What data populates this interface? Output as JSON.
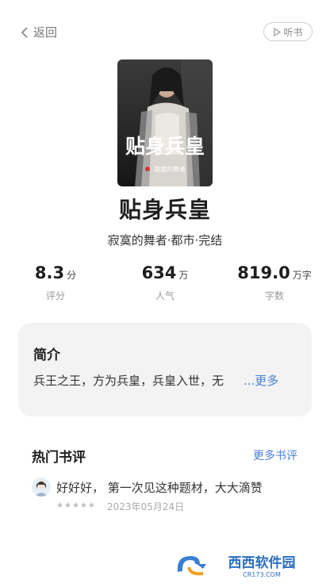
{
  "header": {
    "back_label": "返回",
    "listen_label": "听书"
  },
  "book": {
    "cover_title": "贴身兵皇",
    "cover_author": "寂寞的舞者",
    "title": "贴身兵皇",
    "meta": "寂寞的舞者·都市·完结"
  },
  "stats": [
    {
      "value": "8.3",
      "unit": "分",
      "label": "评分"
    },
    {
      "value": "634",
      "unit": "万",
      "label": "人气"
    },
    {
      "value": "819.0",
      "unit": "万字",
      "label": "字数"
    }
  ],
  "intro": {
    "heading": "简介",
    "text": "兵王之王，方为兵皇，兵皇入世，无",
    "more": "...更多"
  },
  "reviews": {
    "heading": "热门书评",
    "more": "更多书评",
    "items": [
      {
        "text": "好好好， 第一次见这种题材，大大滴赞",
        "rating": 5,
        "date": "2023年05月24日"
      }
    ]
  },
  "watermark": {
    "text": "西西软件园",
    "url": "CR173.COM"
  },
  "colors": {
    "accent": "#4a7fd4",
    "card_bg": "#f3f3f3"
  }
}
